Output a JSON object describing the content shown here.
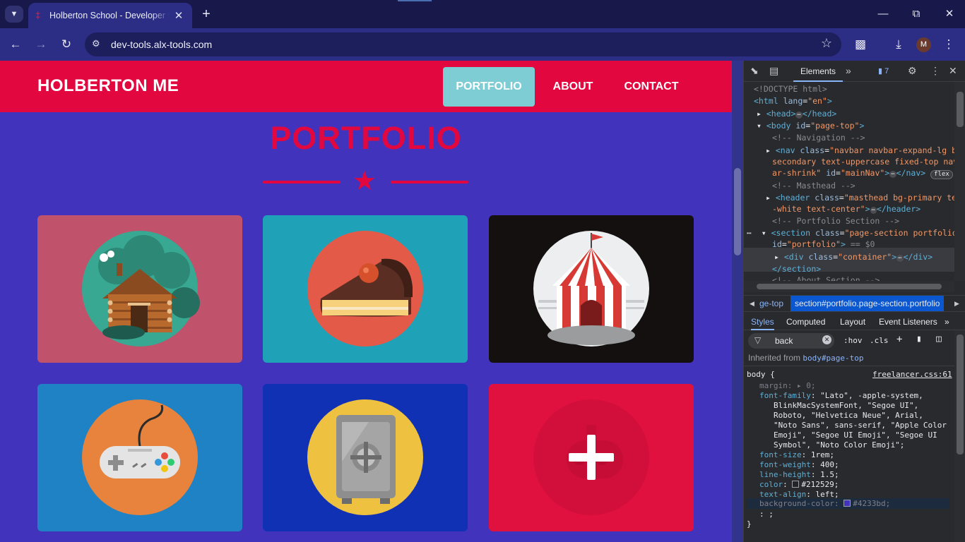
{
  "browser": {
    "tab_title": "Holberton School - Developer to",
    "url": "dev-tools.alx-tools.com",
    "profile_initial": "M"
  },
  "page": {
    "brand": "HOLBERTON ME",
    "nav": {
      "portfolio": "PORTFOLIO",
      "about": "ABOUT",
      "contact": "CONTACT"
    },
    "section_heading": "PORTFOLIO",
    "colors": {
      "background": "#4233bd",
      "navbar": "#e2083f",
      "active_link": "#7fcdd4"
    },
    "portfolio_items": [
      {
        "icon": "cabin-icon",
        "bg": "#c0526b"
      },
      {
        "icon": "cake-icon",
        "bg": "#1fa2b8"
      },
      {
        "icon": "circus-tent-icon",
        "bg": "#13100f"
      },
      {
        "icon": "game-controller-icon",
        "bg": "#1f82c4"
      },
      {
        "icon": "safe-icon",
        "bg": "#1131b5"
      },
      {
        "icon": "submarine-icon",
        "bg": "#e0113f"
      }
    ]
  },
  "devtools": {
    "panel_tab": "Elements",
    "issues_count": "7",
    "dom": {
      "doctype": "<!DOCTYPE html>",
      "html_open": "<html",
      "html_attr": "lang",
      "html_val": "\"en\"",
      "head_open": "<head>",
      "head_close": "</head>",
      "body_open": "<body",
      "body_attr": "id",
      "body_val": "\"page-top\"",
      "comment_nav": "<!-- Navigation -->",
      "nav_l1_tag": "<nav",
      "nav_l1_attr": "class",
      "nav_l1_val": "\"navbar navbar-expand-lg bg-",
      "nav_l2_val": "secondary text-uppercase fixed-top navb",
      "nav_l3_val": "ar-shrink\"",
      "nav_l3_attr": "id",
      "nav_l3_val2": "\"mainNav\"",
      "nav_l3_close": "</nav>",
      "nav_badge": "flex",
      "comment_masthead": "<!-- Masthead -->",
      "header_tag": "<header",
      "header_attr": "class",
      "header_val": "\"masthead bg-primary text",
      "header_val2": "-white text-center\"",
      "header_close": "</header>",
      "comment_portfolio": "<!-- Portfolio Section -->",
      "section_tag": "<section",
      "section_attr": "class",
      "section_val": "\"page-section portfolio\"",
      "section_attr2": "id",
      "section_val2": "\"portfolio\"",
      "section_marker": "== $0",
      "div_tag": "<div",
      "div_attr": "class",
      "div_val": "\"container\"",
      "div_close": "</div>",
      "section_close": "</section>",
      "comment_about": "<!-- About Section -->"
    },
    "breadcrumb": {
      "prev": "ge-top",
      "current": "section#portfolio.page-section.portfolio"
    },
    "style_tabs": [
      "Styles",
      "Computed",
      "Layout",
      "Event Listeners"
    ],
    "filter_value": "back",
    "hov": ":hov",
    "cls": ".cls",
    "inherited_label": "Inherited from",
    "inherited_from": "body#page-top",
    "rule_selector": "body {",
    "rule_source": "freelancer.css:61",
    "props": {
      "margin_name": "margin",
      "margin_val": "0;",
      "ff_name": "font-family",
      "ff_1": "\"Lato\", -apple-system,",
      "ff_2": "BlinkMacSystemFont, \"Segoe UI\",",
      "ff_3": "Roboto, \"Helvetica Neue\", Arial,",
      "ff_4": "\"Noto Sans\", sans-serif, \"Apple Color",
      "ff_5": "Emoji\", \"Segoe UI Emoji\", \"Segoe UI",
      "ff_6": "Symbol\", \"Noto Color Emoji\";",
      "fs_name": "font-size",
      "fs_val": "1rem;",
      "fw_name": "font-weight",
      "fw_val": "400;",
      "lh_name": "line-height",
      "lh_val": "1.5;",
      "color_name": "color",
      "color_val": "#212529;",
      "ta_name": "text-align",
      "ta_val": "left;",
      "bg_name": "background-color",
      "bg_val": "#4233bd;",
      "empty_line": ": ;",
      "close_brace": "}"
    }
  }
}
